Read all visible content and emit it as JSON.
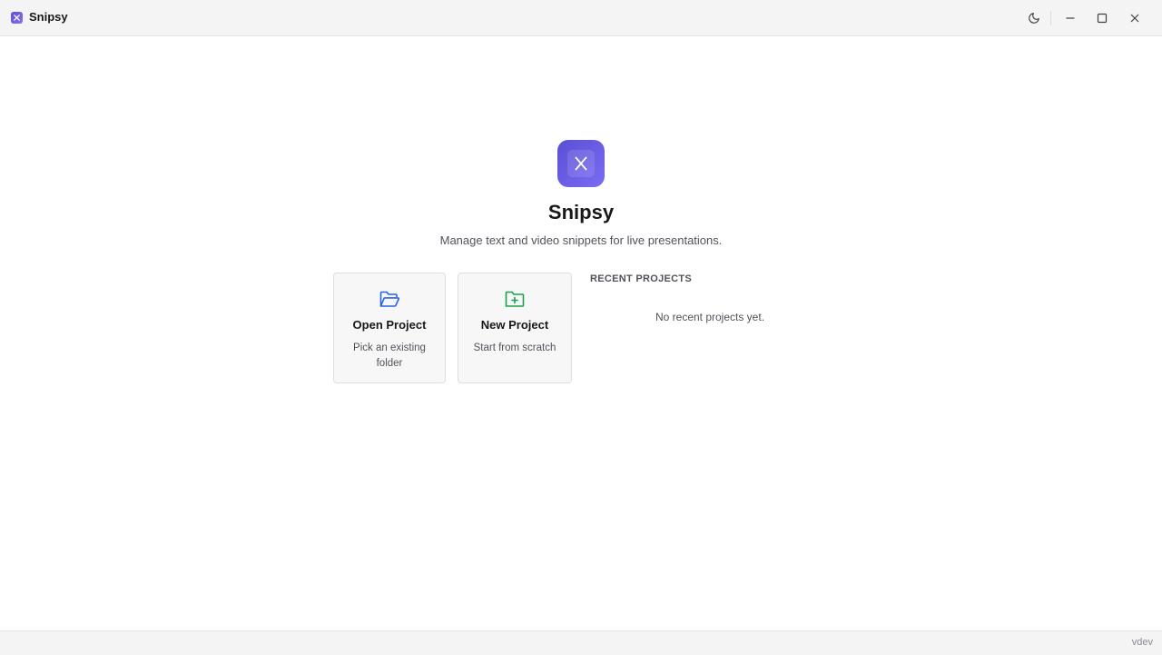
{
  "window": {
    "title": "Snipsy",
    "icon": "scissors-icon",
    "controls": [
      "theme-toggle-moon-icon",
      "minimize-icon",
      "maximize-icon",
      "close-icon"
    ]
  },
  "hero": {
    "logo_icon": "scissors-icon",
    "title": "Snipsy",
    "subtitle": "Manage text and video snippets for live presentations."
  },
  "actions": [
    {
      "icon": "folder-open-icon",
      "title": "Open Project",
      "description": "Pick an existing folder",
      "color": "#2563eb"
    },
    {
      "icon": "folder-plus-icon",
      "title": "New Project",
      "description": "Start from scratch",
      "color": "#16a34a"
    }
  ],
  "recent": {
    "header": "RECENT PROJECTS",
    "empty_text": "No recent projects yet."
  },
  "status": {
    "version": "vdev"
  },
  "colors": {
    "brand": "#5b4fd6",
    "titlebar_bg": "#f4f4f5"
  }
}
